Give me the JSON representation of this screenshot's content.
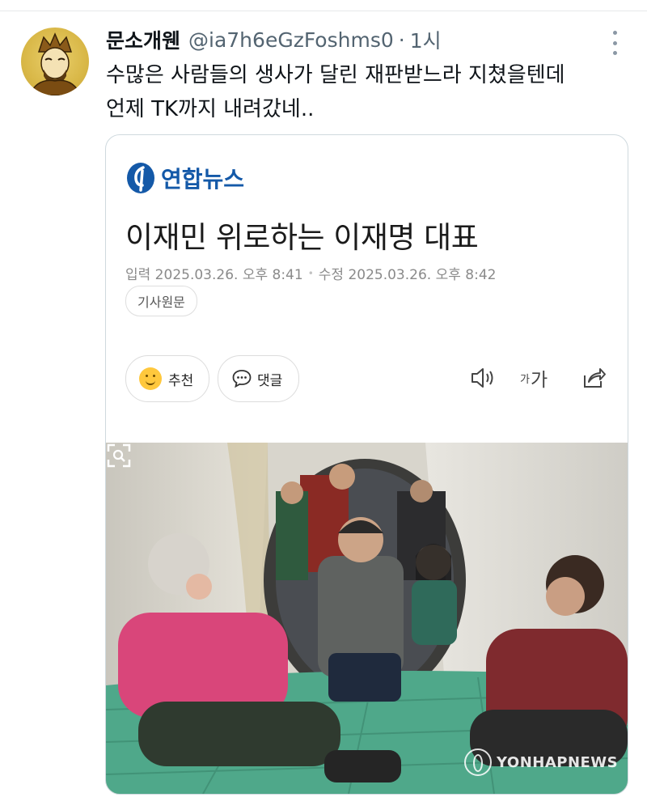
{
  "tweet": {
    "display_name": "문소개웬",
    "handle": "@ia7h6eGzFoshms0",
    "separator": "·",
    "time": "1시",
    "text_lines": [
      "수많은 사람들의 생사가 달린 재판받느라 지쳤을텐데",
      "언제 TK까지 내려갔네.."
    ]
  },
  "article": {
    "source": "연합뉴스",
    "headline": "이재민 위로하는 이재명 대표",
    "input_date": "입력 2025.03.26. 오후 8:41",
    "edit_date": "수정 2025.03.26. 오후 8:42",
    "date_separator": "•",
    "source_chip": "기사원문",
    "recommend_label": "추천",
    "comment_label": "댓글",
    "font_small": "가",
    "font_large": "가",
    "photo_watermark": "YONHAPNEWS"
  },
  "icons": {
    "more": "more-vertical-icon",
    "smile": "smile-emoji-icon",
    "comment": "speech-bubble-icon",
    "speaker": "speaker-icon",
    "font": "font-size-icon",
    "share": "share-icon",
    "expand": "expand-image-icon"
  },
  "colors": {
    "text": "#0f1419",
    "muted": "#536471",
    "yonhap_blue": "#1459a8",
    "border": "#cfd9de"
  }
}
